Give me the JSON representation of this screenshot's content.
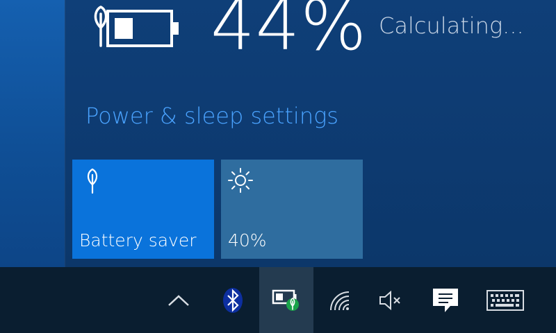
{
  "battery": {
    "percent_text": "44%",
    "percent": 44,
    "status": "Calculating..."
  },
  "settings_link": "Power & sleep settings",
  "tiles": {
    "battery_saver": {
      "label": "Battery saver",
      "icon": "leaf-icon"
    },
    "brightness": {
      "label": "40%",
      "icon": "sun-icon",
      "level": 40
    }
  },
  "tray": [
    {
      "name": "show-hidden-icons",
      "icon": "chevron-up-icon"
    },
    {
      "name": "bluetooth",
      "icon": "bluetooth-icon"
    },
    {
      "name": "battery",
      "icon": "battery-leaf-icon"
    },
    {
      "name": "network",
      "icon": "wifi-icon"
    },
    {
      "name": "volume",
      "icon": "speaker-muted-icon"
    },
    {
      "name": "action-center",
      "icon": "notification-icon"
    },
    {
      "name": "touch-keyboard",
      "icon": "keyboard-icon"
    }
  ],
  "colors": {
    "link": "#4aa3ff",
    "tile_active": "#0a73db",
    "tile_inactive": "#2f6d9f",
    "taskbar": "#0a1e30",
    "battery_badge": "#1aa34a"
  }
}
